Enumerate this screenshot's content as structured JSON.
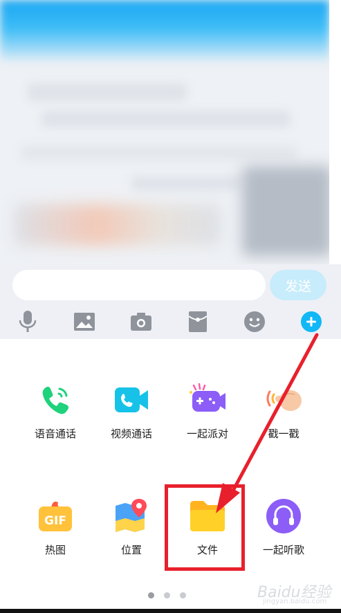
{
  "chat": {},
  "input": {
    "placeholder": "",
    "send_label": "发送"
  },
  "toolbar": {
    "icons": [
      "microphone-icon",
      "image-icon",
      "camera-icon",
      "red-packet-icon",
      "emoji-icon",
      "plus-icon"
    ]
  },
  "colors": {
    "accent": "#12b7f5",
    "send_disabled": "#c7ecfb",
    "highlight": "#e8202c"
  },
  "apps": [
    {
      "label": "语音通话",
      "icon": "phone-call-icon"
    },
    {
      "label": "视频通话",
      "icon": "video-call-icon"
    },
    {
      "label": "一起派对",
      "icon": "game-party-icon"
    },
    {
      "label": "戳一戳",
      "icon": "poke-hand-icon"
    },
    {
      "label": "热图",
      "icon": "gif-icon"
    },
    {
      "label": "位置",
      "icon": "location-map-icon"
    },
    {
      "label": "文件",
      "icon": "folder-icon"
    },
    {
      "label": "一起听歌",
      "icon": "headphones-icon"
    }
  ],
  "pager": {
    "pages": 3,
    "current": 1
  },
  "watermark": {
    "text": "Baidu经验",
    "sub": "jingyan.baidu.com"
  }
}
